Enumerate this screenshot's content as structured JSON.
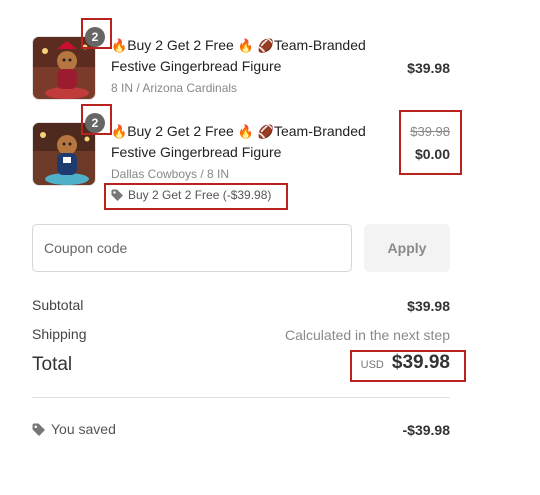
{
  "items": [
    {
      "quantity": "2",
      "title_line1": "Buy 2 Get 2 Free",
      "title_suffix": "Team-Branded",
      "title_line2": "Festive Gingerbread Figure",
      "variant": "8 IN / Arizona Cardinals",
      "price": "$39.98",
      "team_color": "#9b1c2e"
    },
    {
      "quantity": "2",
      "title_line1": "Buy 2 Get 2 Free",
      "title_suffix": "Team-Branded",
      "title_line2": "Festive Gingerbread Figure",
      "variant": "Dallas Cowboys / 8 IN",
      "original_price": "$39.98",
      "price": "$0.00",
      "discount_tag": "Buy 2 Get 2 Free (-$39.98)",
      "team_color": "#1f3a6e"
    }
  ],
  "coupon": {
    "placeholder": "Coupon code",
    "value": "",
    "apply_label": "Apply"
  },
  "summary": {
    "subtotal_label": "Subtotal",
    "subtotal_value": "$39.98",
    "shipping_label": "Shipping",
    "shipping_value": "Calculated in the next step",
    "total_label": "Total",
    "currency": "USD",
    "total_value": "$39.98",
    "saved_label": "You saved",
    "saved_value": "-$39.98"
  },
  "icons": [
    "fire-emoji",
    "football-emoji",
    "tag-icon"
  ],
  "colors": {
    "highlight": "#b8231d",
    "badge": "#666666"
  }
}
